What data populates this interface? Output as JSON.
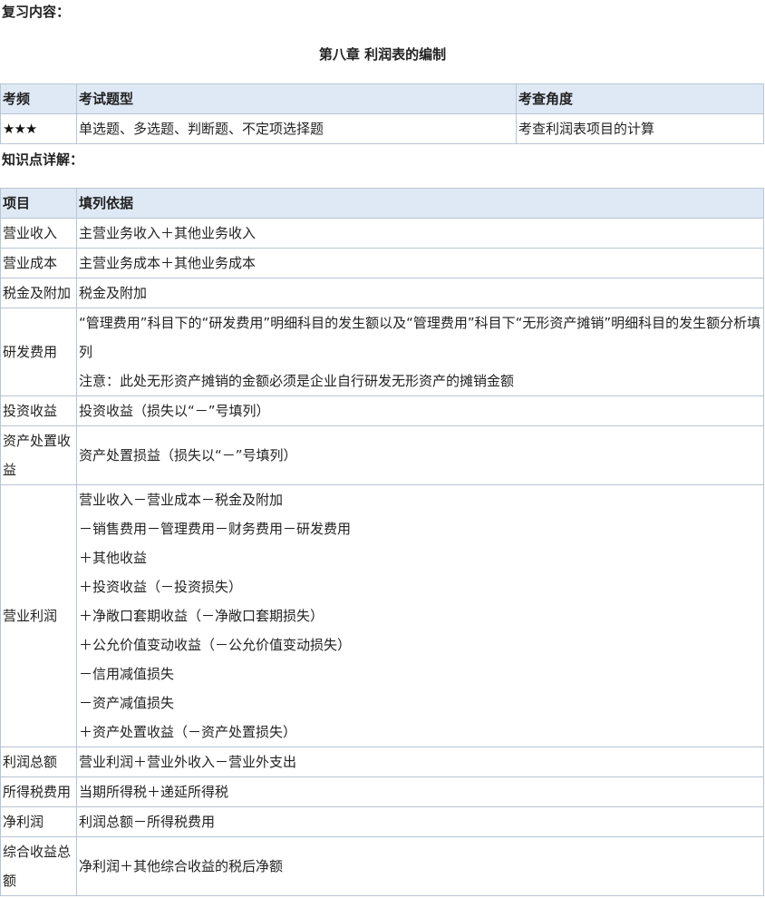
{
  "review_label": "复习内容：",
  "chapter_title": "第八章  利润表的编制",
  "overview": {
    "headers": [
      "考频",
      "考试题型",
      "考查角度"
    ],
    "row": [
      "★★★",
      "单选题、多选题、判断题、不定项选择题",
      "考查利润表项目的计算"
    ]
  },
  "detail_label": "知识点详解：",
  "detail": {
    "headers": [
      "项目",
      "填列依据"
    ],
    "rows": [
      {
        "item": "营业收入",
        "lines": [
          "主营业务收入＋其他业务收入"
        ]
      },
      {
        "item": "营业成本",
        "lines": [
          "主营业务成本＋其他业务成本"
        ]
      },
      {
        "item": "税金及附加",
        "lines": [
          "税金及附加"
        ]
      },
      {
        "item": "研发费用",
        "lines": [
          "“管理费用”科目下的“研发费用”明细科目的发生额以及“管理费用”科目下“无形资产摊销”明细科目的发生额分析填列",
          "注意：此处无形资产摊销的金额必须是企业自行研发无形资产的摊销金额"
        ]
      },
      {
        "item": "投资收益",
        "lines": [
          "投资收益（损失以“－”号填列）"
        ]
      },
      {
        "item": "资产处置收益",
        "lines": [
          "资产处置损益（损失以“－”号填列）"
        ]
      },
      {
        "item": "营业利润",
        "lines": [
          "营业收入－营业成本－税金及附加",
          "－销售费用－管理费用－财务费用－研发费用",
          "＋其他收益",
          "＋投资收益（－投资损失）",
          "＋净敞口套期收益（－净敞口套期损失）",
          "＋公允价值变动收益（－公允价值变动损失）",
          "－信用减值损失",
          "－资产减值损失",
          "＋资产处置收益（－资产处置损失）"
        ]
      },
      {
        "item": "利润总额",
        "lines": [
          "营业利润＋营业外收入－营业外支出"
        ]
      },
      {
        "item": "所得税费用",
        "lines": [
          "当期所得税＋递延所得税"
        ]
      },
      {
        "item": "净利润",
        "lines": [
          "利润总额－所得税费用"
        ]
      },
      {
        "item": "综合收益总额",
        "lines": [
          "净利润＋其他综合收益的税后净额"
        ]
      }
    ]
  }
}
